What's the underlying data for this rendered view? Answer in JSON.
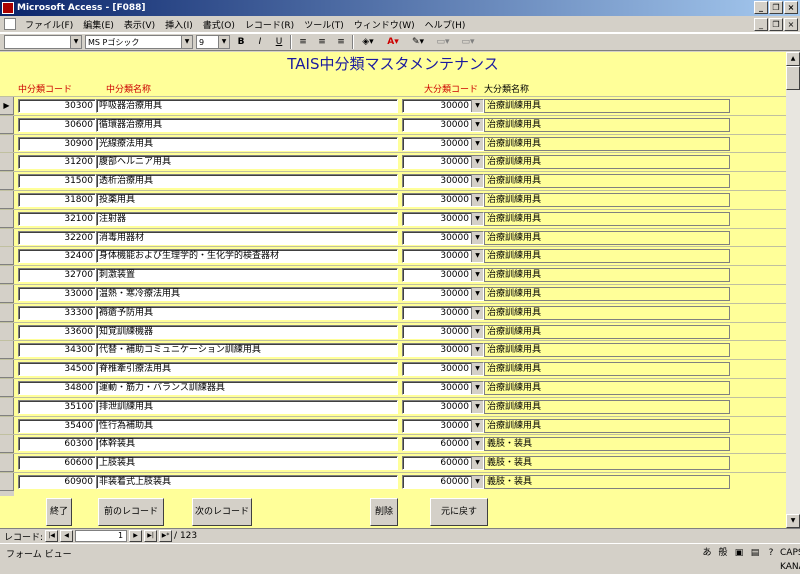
{
  "window": {
    "title": "Microsoft Access - [F088]",
    "buttons": [
      "_",
      "❐",
      "×"
    ]
  },
  "menu": [
    "ファイル(F)",
    "編集(E)",
    "表示(V)",
    "挿入(I)",
    "書式(O)",
    "レコード(R)",
    "ツール(T)",
    "ウィンドウ(W)",
    "ヘルプ(H)"
  ],
  "toolbar": {
    "font": "MS Pゴシック",
    "size": "9",
    "bold": "B",
    "italic": "I",
    "underline": "U"
  },
  "form": {
    "title": "TAIS中分類マスタメンテナンス",
    "headers": {
      "code": "中分類コード",
      "name": "中分類名称",
      "cat_code": "大分類コード",
      "cat_name": "大分類名称"
    },
    "accent": "#cc0000",
    "rows": [
      {
        "code": "30300",
        "name": "呼吸器治療用具",
        "cat": "30000",
        "catname": "治療訓練用具"
      },
      {
        "code": "30600",
        "name": "循環器治療用具",
        "cat": "30000",
        "catname": "治療訓練用具"
      },
      {
        "code": "30900",
        "name": "光線療法用具",
        "cat": "30000",
        "catname": "治療訓練用具"
      },
      {
        "code": "31200",
        "name": "腹部ヘルニア用具",
        "cat": "30000",
        "catname": "治療訓練用具"
      },
      {
        "code": "31500",
        "name": "透析治療用具",
        "cat": "30000",
        "catname": "治療訓練用具"
      },
      {
        "code": "31800",
        "name": "投薬用具",
        "cat": "30000",
        "catname": "治療訓練用具"
      },
      {
        "code": "32100",
        "name": "注射器",
        "cat": "30000",
        "catname": "治療訓練用具"
      },
      {
        "code": "32200",
        "name": "消毒用器材",
        "cat": "30000",
        "catname": "治療訓練用具"
      },
      {
        "code": "32400",
        "name": "身体機能および生理学的・生化学的検査器材",
        "cat": "30000",
        "catname": "治療訓練用具"
      },
      {
        "code": "32700",
        "name": "刺激装置",
        "cat": "30000",
        "catname": "治療訓練用具"
      },
      {
        "code": "33000",
        "name": "温熱・寒冷療法用具",
        "cat": "30000",
        "catname": "治療訓練用具"
      },
      {
        "code": "33300",
        "name": "褥瘡予防用具",
        "cat": "30000",
        "catname": "治療訓練用具"
      },
      {
        "code": "33600",
        "name": "知覚訓練機器",
        "cat": "30000",
        "catname": "治療訓練用具"
      },
      {
        "code": "34300",
        "name": "代替・補助コミュニケーション訓練用具",
        "cat": "30000",
        "catname": "治療訓練用具"
      },
      {
        "code": "34500",
        "name": "脊椎牽引療法用具",
        "cat": "30000",
        "catname": "治療訓練用具"
      },
      {
        "code": "34800",
        "name": "運動・筋力・バランス訓練器具",
        "cat": "30000",
        "catname": "治療訓練用具"
      },
      {
        "code": "35100",
        "name": "排泄訓練用具",
        "cat": "30000",
        "catname": "治療訓練用具"
      },
      {
        "code": "35400",
        "name": "性行為補助具",
        "cat": "30000",
        "catname": "治療訓練用具"
      },
      {
        "code": "60300",
        "name": "体幹装具",
        "cat": "60000",
        "catname": "義肢・装具"
      },
      {
        "code": "60600",
        "name": "上肢装具",
        "cat": "60000",
        "catname": "義肢・装具"
      },
      {
        "code": "60900",
        "name": "非装着式上肢装具",
        "cat": "60000",
        "catname": "義肢・装具"
      }
    ]
  },
  "buttons": {
    "close": "終了",
    "prev": "前のレコード",
    "next": "次のレコード",
    "delete": "削除",
    "undo": "元に戻す"
  },
  "nav": {
    "label": "レコード:",
    "current": "1",
    "total": "/ 123"
  },
  "status": {
    "text": "フォーム ビュー",
    "ime": [
      "あ",
      "般",
      "CAPS",
      "KANA"
    ]
  }
}
